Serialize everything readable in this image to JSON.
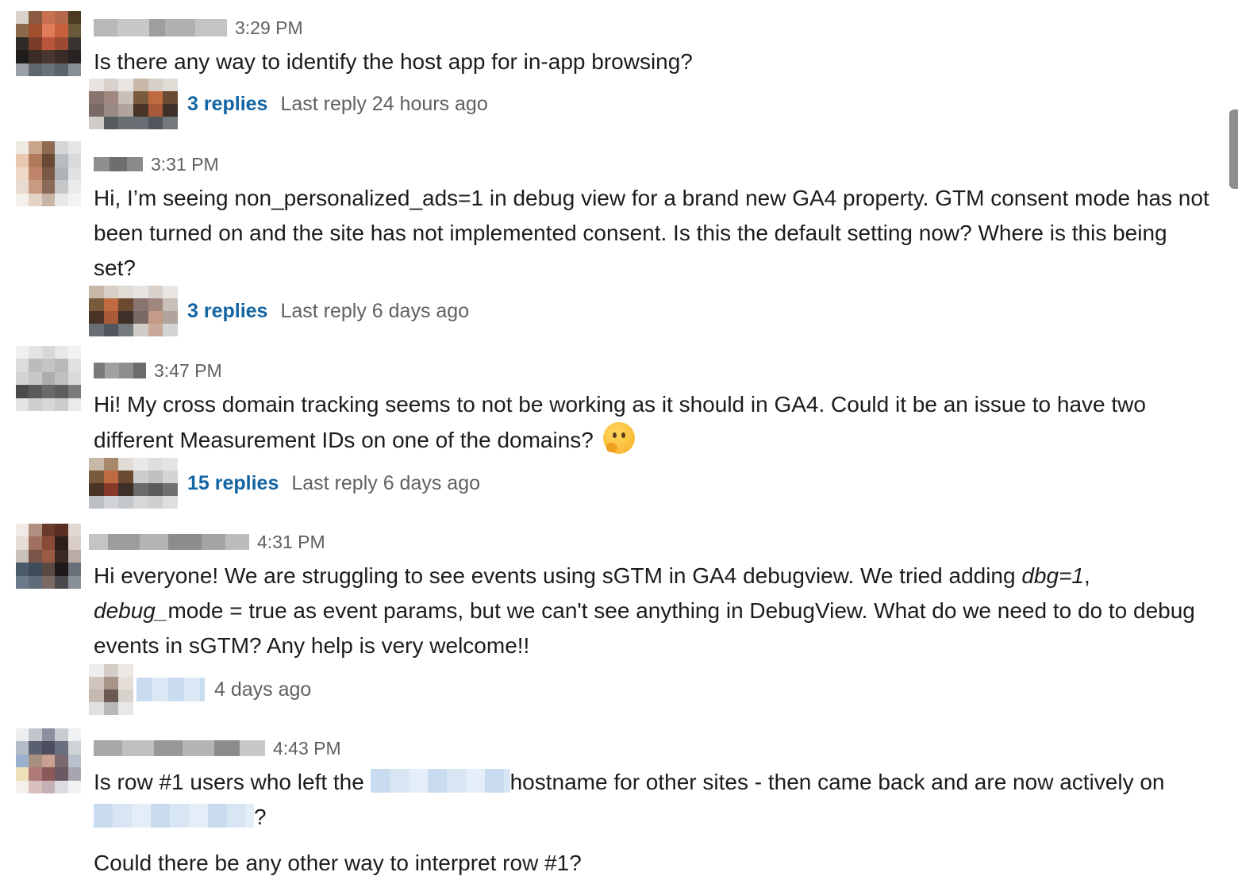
{
  "messages": [
    {
      "time": "3:29 PM",
      "text": "Is there any way to identify the host app for in-app browsing?",
      "thread": {
        "replies": "3 replies",
        "last_reply": "Last reply 24 hours ago"
      }
    },
    {
      "time": "3:31 PM",
      "text": "Hi, I’m seeing non_personalized_ads=1 in debug view for a brand new GA4 property. GTM consent mode has not been turned on and the site has not implemented consent.  Is this the default setting now?  Where is this being set?",
      "thread": {
        "replies": "3 replies",
        "last_reply": "Last reply 6 days ago"
      }
    },
    {
      "time": "3:47 PM",
      "text": "Hi! My cross domain tracking seems to not be working as it should in GA4. Could it be an issue to have two different Measurement IDs on one of the domains?",
      "emoji": "thinking-face",
      "thread": {
        "replies": "15 replies",
        "last_reply": "Last reply 6 days ago"
      }
    },
    {
      "time": "4:31 PM",
      "text_part1": "Hi everyone! We are struggling to see events using sGTM in GA4 debugview. We tried adding ",
      "text_em1": "dbg=1",
      "text_part2": ", ",
      "text_em2": "debug_",
      "text_part3": "mode = true as event params, but we can't see anything in DebugView. What do we need to do to debug events in sGTM? Any help is very welcome!!",
      "thread": {
        "last_reply": "4 days ago"
      }
    },
    {
      "time": "4:43 PM",
      "text_part1": "Is row #1 users who left the ",
      "text_part2": "hostname for other sites - then came back and are now actively on ",
      "text_part3": "?",
      "text_p2": "Could there be any other way to interpret row #1?"
    }
  ],
  "colors": {
    "link": "#1264a3",
    "meta": "#616061",
    "text": "#1d1c1d"
  }
}
